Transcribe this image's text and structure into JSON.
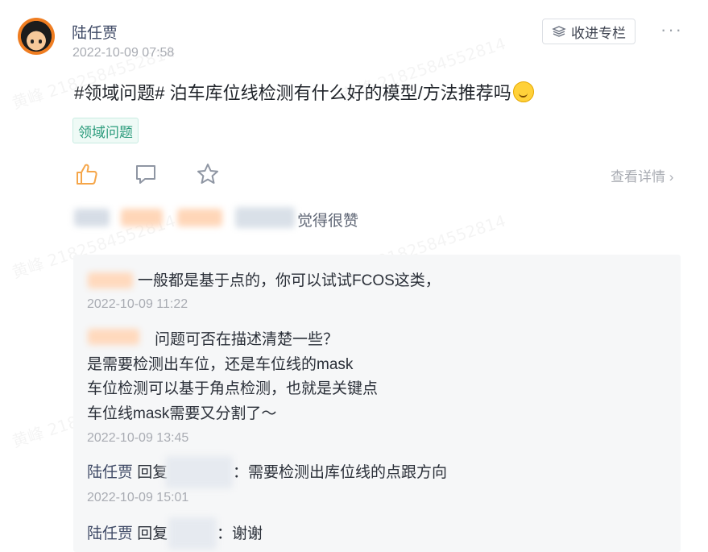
{
  "watermark": "黄峰 2182584552814",
  "post": {
    "author": "陆任贾",
    "time": "2022-10-09 07:58",
    "collect_label": "收进专栏",
    "more_label": "···",
    "text": "#领域问题# 泊车库位线检测有什么好的模型/方法推荐吗",
    "tag": "领域问题",
    "details_label": "查看详情"
  },
  "likes": {
    "suffix": "觉得很赞"
  },
  "comments": [
    {
      "text": "一般都是基于点的，你可以试试FCOS这类，",
      "time": "2022-10-09 11:22"
    },
    {
      "lines": [
        "问题可否在描述清楚一些？",
        "是需要检测出车位，还是车位线的mask",
        "车位检测可以基于角点检测，也就是关键点",
        "车位线mask需要又分割了～"
      ],
      "time": "2022-10-09 13:45"
    },
    {
      "author": "陆任贾",
      "reply_word": "回复",
      "text": "：需要检测出库位线的点跟方向",
      "time": "2022-10-09 15:01"
    },
    {
      "author": "陆任贾",
      "reply_word": "回复",
      "text": "：谢谢"
    }
  ],
  "colors": {
    "accent": "#3f4a66",
    "like_active": "#f5a64a",
    "tag_green": "#2a9b7b",
    "muted": "#a9acb3"
  }
}
